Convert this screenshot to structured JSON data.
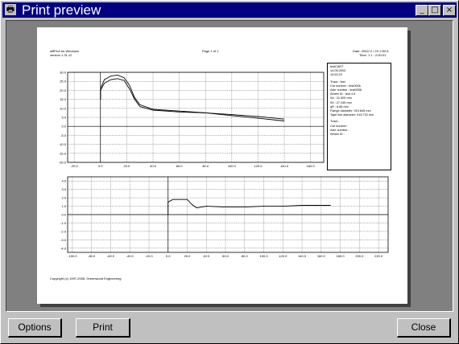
{
  "window": {
    "title": "Print preview",
    "icon": "printer-icon",
    "controls": [
      "_",
      "□",
      "×"
    ]
  },
  "buttons": {
    "options": "Options",
    "print": "Print",
    "close": "Close"
  },
  "page": {
    "left_header": "diffProf for Windows",
    "left_header2": "version 1.31.12",
    "center_header": "Page 1 of 1",
    "right_header": "Date: 2002/ 2 / 2X   2:52:5",
    "right_header2": "Time: 1 1 : 2:00:01",
    "footer": "Copyright (c) 1997-2006, Greenwood Engineering"
  },
  "info_panel": {
    "lines": [
      "testCART",
      "14-05-2002",
      "10:00:23",
      "Track          : test",
      "Car number     : test0006",
      "Axle number    : test0006",
      "Wheel ID       : test 4.5",
      "Sd             : 21.500 mm",
      "Sh             : 27.245 mm",
      "qR             : 6.86 mm",
      "Flange diameter: 919.845 mm",
      "Tape line diameter: 919.732 mm",
      "Track          :",
      "Car number     :",
      "Axle number    :",
      "Wheel ID       :"
    ]
  },
  "chart_data": [
    {
      "type": "line",
      "title": "",
      "xlabel": "",
      "ylabel": "",
      "x_ticks": [
        "-20.0",
        "0.0",
        "20.0",
        "40.0",
        "60.0",
        "80.0",
        "100.0",
        "120.0",
        "140.0",
        "160.0"
      ],
      "y_ticks": [
        "30.0",
        "25.0",
        "20.0",
        "15.0",
        "10.0",
        "5.0",
        "0.0",
        "-5.0",
        "-10.0",
        "-15.0",
        "-20.0"
      ],
      "xlim": [
        -25,
        170
      ],
      "ylim": [
        -20,
        30
      ],
      "series": [
        {
          "x": [
            0,
            0,
            3,
            8,
            13,
            18,
            22,
            26,
            30,
            40,
            60,
            80,
            100,
            120,
            140
          ],
          "y": [
            15,
            20,
            24,
            26,
            26.5,
            25.5,
            21,
            15,
            11,
            9,
            8,
            7.5,
            6.5,
            5.5,
            4
          ]
        },
        {
          "x": [
            0,
            0,
            3,
            8,
            13,
            18,
            22,
            26,
            30,
            40,
            60,
            80,
            100,
            120,
            140
          ],
          "y": [
            15,
            21,
            26,
            28,
            28.5,
            27,
            23,
            16,
            12,
            9.5,
            8.5,
            7.5,
            6,
            4.5,
            3
          ]
        }
      ]
    },
    {
      "type": "line",
      "title": "",
      "xlabel": "",
      "ylabel": "",
      "x_ticks": [
        "-100.0",
        "-80.0",
        "-60.0",
        "-40.0",
        "-20.0",
        "0.0",
        "20.0",
        "40.0",
        "60.0",
        "80.0",
        "100.0",
        "120.0",
        "140.0",
        "160.0",
        "180.0",
        "200.0",
        "220.0"
      ],
      "y_ticks": [
        "4.0",
        "3.0",
        "2.0",
        "1.0",
        "0.0",
        "-1.0",
        "-2.0",
        "-3.0",
        "-4.0"
      ],
      "xlim": [
        -105,
        230
      ],
      "ylim": [
        -4.5,
        4.5
      ],
      "series": [
        {
          "x": [
            0,
            0,
            5,
            8,
            20,
            25,
            30,
            35,
            40,
            60,
            80,
            100,
            120,
            140,
            160,
            170
          ],
          "y": [
            0,
            1.5,
            1.8,
            1.8,
            1.8,
            1.2,
            0.8,
            0.9,
            1.0,
            0.9,
            0.9,
            1.0,
            1.0,
            1.1,
            1.1,
            1.1
          ]
        }
      ]
    }
  ]
}
